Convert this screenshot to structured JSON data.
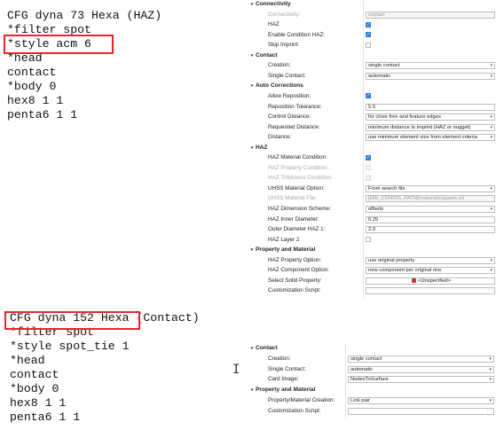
{
  "block1": {
    "lines": [
      "CFG dyna 73 Hexa (HAZ)",
      "*filter spot",
      "*style acm 6",
      "*head",
      "contact",
      "*body 0",
      "hex8 1 1",
      "penta6 1 1"
    ]
  },
  "block2": {
    "lines": [
      "CFG dyna 152 Hexa (Contact)",
      "*filter spot",
      "*style spot_tie 1",
      "*head",
      "contact",
      "*body 0",
      "hex8 1 1",
      "penta6 1 1"
    ]
  },
  "panel1": {
    "rows": [
      {
        "kind": "section",
        "label": "Connectivity"
      },
      {
        "kind": "text",
        "label": "Connectivity:",
        "value": "contact",
        "disabled": true
      },
      {
        "kind": "check",
        "label": "HAZ",
        "checked": true
      },
      {
        "kind": "check",
        "label": "Enable Condition HAZ:",
        "checked": true
      },
      {
        "kind": "check",
        "label": "Skip Imprint:",
        "checked": false
      },
      {
        "kind": "section",
        "label": "Contact"
      },
      {
        "kind": "select",
        "label": "Creation:",
        "value": "single contact"
      },
      {
        "kind": "select",
        "label": "Single Contact:",
        "value": "automatic"
      },
      {
        "kind": "section",
        "label": "Auto Corrections"
      },
      {
        "kind": "check",
        "label": "Allow Reposition:",
        "checked": true
      },
      {
        "kind": "text",
        "label": "Reposition Tolerance:",
        "value": "5.5"
      },
      {
        "kind": "select",
        "label": "Control Distance:",
        "value": "for close free and feature edges"
      },
      {
        "kind": "select",
        "label": "Requested Distance:",
        "value": "minimum distance to imprint (HAZ or nugget)"
      },
      {
        "kind": "select",
        "label": "Distance:",
        "value": "use minimum element size from element criteria"
      },
      {
        "kind": "section",
        "label": "HAZ"
      },
      {
        "kind": "check",
        "label": "HAZ Material Condition:",
        "checked": true
      },
      {
        "kind": "check",
        "label": "HAZ Property Condition:",
        "checked": false,
        "disabled": true
      },
      {
        "kind": "check",
        "label": "HAZ Thickness Condition:",
        "checked": false,
        "disabled": true
      },
      {
        "kind": "select",
        "label": "UHSS Material Option:",
        "value": "From search file"
      },
      {
        "kind": "text",
        "label": "UHSS Material File:",
        "value": "[HW_CONFIG_PATH]/materialsnippets.txt",
        "disabled": true
      },
      {
        "kind": "select",
        "label": "HAZ Dimension Scheme:",
        "value": "offsets"
      },
      {
        "kind": "text",
        "label": "HAZ Inner Diameter:",
        "value": "0.25"
      },
      {
        "kind": "text",
        "label": "Outer Diameter HAZ 1:",
        "value": "2.0"
      },
      {
        "kind": "check",
        "label": "HAZ Layer 2",
        "checked": false
      },
      {
        "kind": "section",
        "label": "Property and Material"
      },
      {
        "kind": "select",
        "label": "HAZ Property Option:",
        "value": "use original property"
      },
      {
        "kind": "select",
        "label": "HAZ Component Option:",
        "value": "new component per original one"
      },
      {
        "kind": "picker",
        "label": "Select Solid Property:",
        "value": "<Unspecified>",
        "icon": "property-icon"
      },
      {
        "kind": "file",
        "label": "Customization Script:",
        "value": ""
      }
    ]
  },
  "panel2": {
    "rows": [
      {
        "kind": "section",
        "label": "Contact"
      },
      {
        "kind": "select",
        "label": "Creation:",
        "value": "single contact"
      },
      {
        "kind": "select",
        "label": "Single Contact:",
        "value": "automatic"
      },
      {
        "kind": "select",
        "label": "Card Image:",
        "value": "NodesToSurface"
      },
      {
        "kind": "section",
        "label": "Property and Material"
      },
      {
        "kind": "select",
        "label": "Property/Material Creation:",
        "value": "Link pair"
      },
      {
        "kind": "file",
        "label": "Customization Script:",
        "value": ""
      }
    ]
  },
  "icons": {
    "dropdown": "▾",
    "collapse": "▾",
    "folder": "🗀",
    "check": "✓"
  }
}
